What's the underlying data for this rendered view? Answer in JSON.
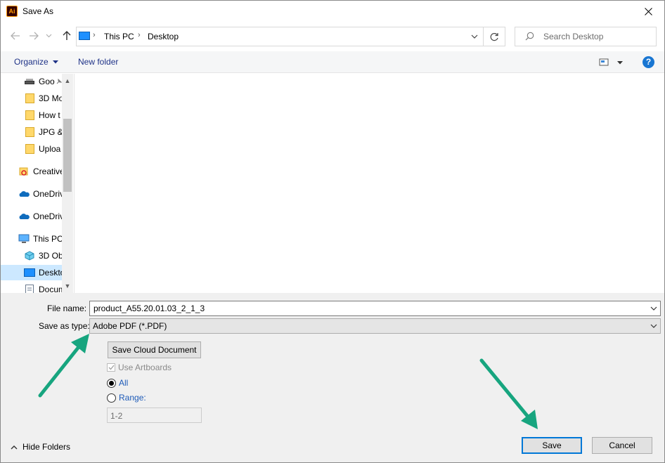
{
  "window": {
    "title": "Save As",
    "app_icon_text": "Ai"
  },
  "address": {
    "crumbs": [
      "This PC",
      "Desktop"
    ]
  },
  "search": {
    "placeholder": "Search Desktop"
  },
  "toolbar": {
    "organize": "Organize",
    "new_folder": "New folder",
    "help": "?"
  },
  "nav": {
    "items": [
      {
        "label": "Goo",
        "icon": "drive-icon",
        "pinned": true
      },
      {
        "label": "3D Mo",
        "icon": "cloud-folder-icon"
      },
      {
        "label": "How t",
        "icon": "folder-icon"
      },
      {
        "label": "JPG &",
        "icon": "cloud-folder-icon"
      },
      {
        "label": "Uploa",
        "icon": "cloud-folder-icon"
      },
      {
        "label": "Creative",
        "icon": "creative-cloud-icon"
      },
      {
        "label": "OneDriv",
        "icon": "onedrive-icon"
      },
      {
        "label": "OneDriv",
        "icon": "onedrive-icon"
      },
      {
        "label": "This PC",
        "icon": "pc-icon"
      },
      {
        "label": "3D Obj",
        "icon": "3d-objects-icon"
      },
      {
        "label": "Deskto",
        "icon": "desktop-icon",
        "selected": true
      },
      {
        "label": "Docum",
        "icon": "documents-icon"
      }
    ]
  },
  "form": {
    "file_name_label": "File name:",
    "file_name_value": "product_A55.20.01.03_2_1_3",
    "save_type_label": "Save as type:",
    "save_type_value": "Adobe PDF (*.PDF)",
    "cloud_button": "Save Cloud Document",
    "use_artboards": "Use Artboards",
    "all_label": "All",
    "range_label": "Range:",
    "range_value": "1-2"
  },
  "footer": {
    "hide_folders": "Hide Folders",
    "save": "Save",
    "cancel": "Cancel"
  },
  "colors": {
    "accent": "#0078d7",
    "annotation_arrow": "#17a57f",
    "link": "#1e3287"
  }
}
